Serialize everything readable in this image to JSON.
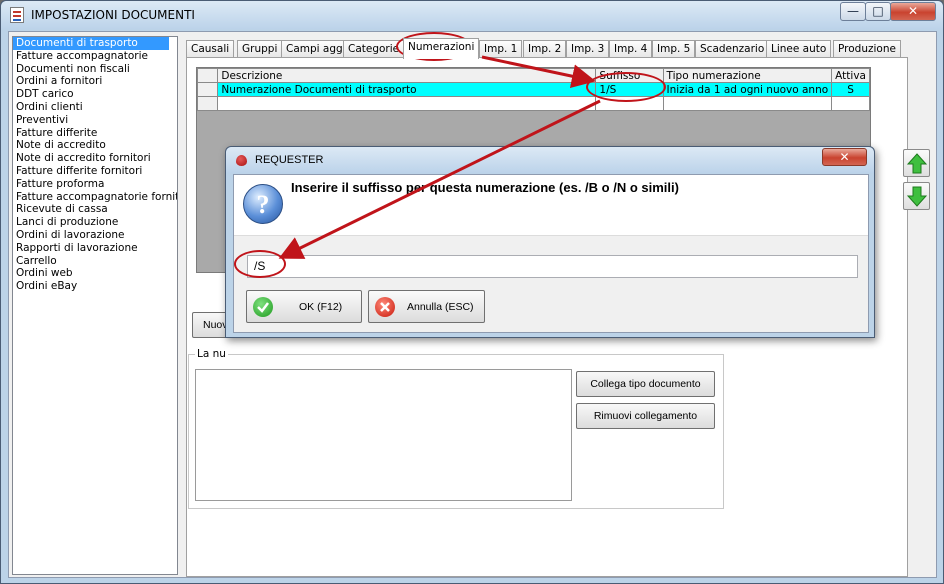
{
  "window": {
    "title": "IMPOSTAZIONI DOCUMENTI",
    "minimize": "—",
    "maximize": "□",
    "close": "✕"
  },
  "doc_types": [
    "Documenti di trasporto",
    "Fatture accompagnatorie",
    "Documenti non fiscali",
    "Ordini a fornitori",
    "DDT carico",
    "Ordini clienti",
    "Preventivi",
    "Fatture differite",
    "Note di accredito",
    "Note di accredito fornitori",
    "Fatture differite fornitori",
    "Fatture proforma",
    "Fatture accompagnatorie fornitori",
    "Ricevute di cassa",
    "Lanci di produzione",
    "Ordini di lavorazione",
    "Rapporti di lavorazione",
    "Carrello",
    "Ordini web",
    "Ordini eBay"
  ],
  "selected_doc_type": "Documenti di trasporto",
  "tabs": [
    "Causali",
    "Gruppi",
    "Campi agg.",
    "Categorie",
    "Numerazioni",
    "Imp. 1",
    "Imp. 2",
    "Imp. 3",
    "Imp. 4",
    "Imp. 5",
    "Scadenzario",
    "Linee auto",
    "Produzione"
  ],
  "active_tab": "Numerazioni",
  "grid": {
    "headers": [
      "Descrizione",
      "Suffisso",
      "Tipo numerazione",
      "Attiva"
    ],
    "rows": [
      [
        "Numerazione Documenti di trasporto",
        "1/S",
        "Inizia da 1 ad ogni nuovo anno",
        "S"
      ]
    ]
  },
  "lower": {
    "new_button": "Nuova",
    "group_label": "La nu",
    "link_doc_type_button": "Collega tipo documento",
    "remove_link_button": "Rimuovi collegamento"
  },
  "dialog": {
    "title": "REQUESTER",
    "close": "✕",
    "message": "Inserire il suffisso per questa numerazione (es. /B o /N o simili)",
    "input_value": "/S",
    "ok_button": "OK (F12)",
    "cancel_button": "Annulla (ESC)"
  },
  "colors": {
    "selected_row": "#00ffff",
    "list_selection": "#3399ff",
    "annotation_red": "#c0141a"
  }
}
